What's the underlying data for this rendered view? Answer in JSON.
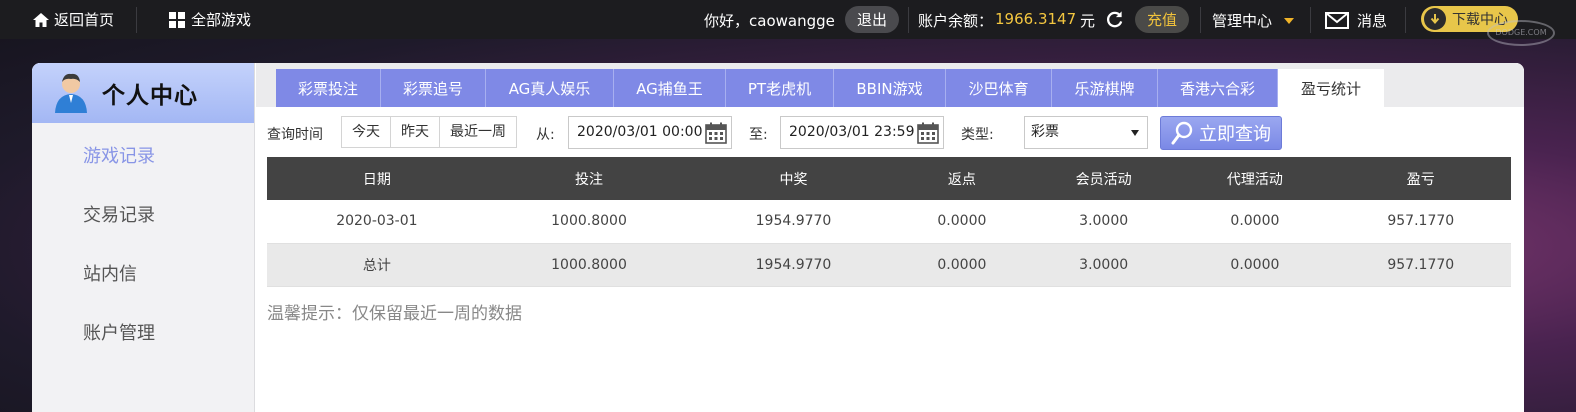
{
  "topbar": {
    "home": "返回首页",
    "all_games": "全部游戏",
    "greeting": "你好，caowangge",
    "logout": "退出",
    "balance_label": "账户余额：",
    "balance_value": "1966.3147",
    "currency": "元",
    "recharge": "充值",
    "manage": "管理中心",
    "messages": "消息",
    "download": "下载中心",
    "watermark": "DODGE.COM"
  },
  "sidebar": {
    "title": "个人中心",
    "items": [
      {
        "label": "游戏记录"
      },
      {
        "label": "交易记录"
      },
      {
        "label": "站内信"
      },
      {
        "label": "账户管理"
      }
    ]
  },
  "tabs": [
    {
      "label": "彩票投注"
    },
    {
      "label": "彩票追号"
    },
    {
      "label": "AG真人娱乐"
    },
    {
      "label": "AG捕鱼王"
    },
    {
      "label": "PT老虎机"
    },
    {
      "label": "BBIN游戏"
    },
    {
      "label": "沙巴体育"
    },
    {
      "label": "乐游棋牌"
    },
    {
      "label": "香港六合彩"
    },
    {
      "label": "盈亏统计"
    }
  ],
  "query": {
    "time_label": "查询时间",
    "today": "今天",
    "yesterday": "昨天",
    "last_week": "最近一周",
    "from_label": "从:",
    "from_value": "2020/03/01 00:00",
    "to_label": "至:",
    "to_value": "2020/03/01 23:59",
    "type_label": "类型:",
    "type_value": "彩票",
    "search": "立即查询"
  },
  "table": {
    "headers": [
      "日期",
      "投注",
      "中奖",
      "返点",
      "会员活动",
      "代理活动",
      "盈亏"
    ],
    "rows": [
      [
        "2020-03-01",
        "1000.8000",
        "1954.9770",
        "0.0000",
        "3.0000",
        "0.0000",
        "957.1770"
      ],
      [
        "总计",
        "1000.8000",
        "1954.9770",
        "0.0000",
        "3.0000",
        "0.0000",
        "957.1770"
      ]
    ]
  },
  "tip": "温馨提示：仅保留最近一周的数据",
  "colors": {
    "accent": "#7f89e6",
    "gold": "#f3c640",
    "header_dark": "#434343"
  }
}
